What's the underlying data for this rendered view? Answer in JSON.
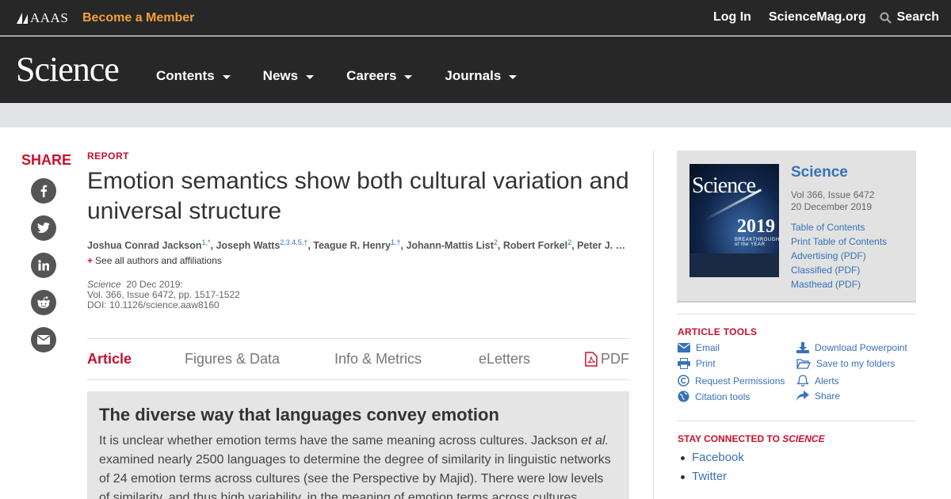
{
  "topbar": {
    "brand": "AAAS",
    "become_member": "Become a Member",
    "login": "Log In",
    "sciencemag": "ScienceMag.org",
    "search": "Search"
  },
  "nav": {
    "logo": "Science",
    "items": [
      "Contents",
      "News",
      "Careers",
      "Journals"
    ]
  },
  "share": {
    "title": "SHARE",
    "icons": [
      "facebook-icon",
      "twitter-icon",
      "linkedin-icon",
      "reddit-icon",
      "email-icon"
    ]
  },
  "article": {
    "type": "REPORT",
    "title": "Emotion semantics show both cultural variation and universal structure",
    "authors": [
      {
        "name": "Joshua Conrad Jackson",
        "sup": "1,*"
      },
      {
        "name": "Joseph Watts",
        "sup": "2,3,4,5,†"
      },
      {
        "name": "Teague R. Henry",
        "sup": "1,†"
      },
      {
        "name": "Johann-Mattis List",
        "sup": "2"
      },
      {
        "name": "Robert Forkel",
        "sup": "2"
      },
      {
        "name": "Peter J. Much…",
        "sup": ""
      }
    ],
    "see_all": "See all authors and affiliations",
    "journal": "Science",
    "date": "20 Dec 2019:",
    "volume": "Vol. 366, Issue 6472, pp. 1517-1522",
    "doi": "DOI: 10.1126/science.aaw8160"
  },
  "tabs": {
    "article": "Article",
    "figures": "Figures & Data",
    "info": "Info & Metrics",
    "eletters": "eLetters",
    "pdf": "PDF"
  },
  "summary": {
    "heading": "The diverse way that languages convey emotion",
    "text_before": "It is unclear whether emotion terms have the same meaning across cultures. Jackson ",
    "text_italic": "et al.",
    "text_after": " examined nearly 2500 languages to determine the degree of similarity in linguistic networks of 24 emotion terms across cultures (see the Perspective by Majid). There were low levels of similarity, and thus high variability, in the meaning of emotion terms across cultures."
  },
  "journal_box": {
    "name": "Science",
    "issue": "Vol 366, Issue 6472",
    "date": "20 December 2019",
    "cover_name": "Science",
    "cover_year": "2019",
    "cover_sub": "BREAKTHROUGH of the YEAR",
    "links": [
      "Table of Contents",
      "Print Table of Contents",
      "Advertising (PDF)",
      "Classified (PDF)",
      "Masthead (PDF)"
    ]
  },
  "tools": {
    "title": "ARTICLE TOOLS",
    "left": [
      "Email",
      "Print",
      "Request Permissions",
      "Citation tools"
    ],
    "right": [
      "Download Powerpoint",
      "Save to my folders",
      "Alerts",
      "Share"
    ]
  },
  "stay": {
    "title_prefix": "STAY CONNECTED TO ",
    "title_journal": "SCIENCE",
    "items": [
      "Facebook",
      "Twitter"
    ]
  },
  "colors": {
    "accent": "#c8102e",
    "link": "#3771b8",
    "header": "#272727",
    "orange": "#f0a23b"
  }
}
